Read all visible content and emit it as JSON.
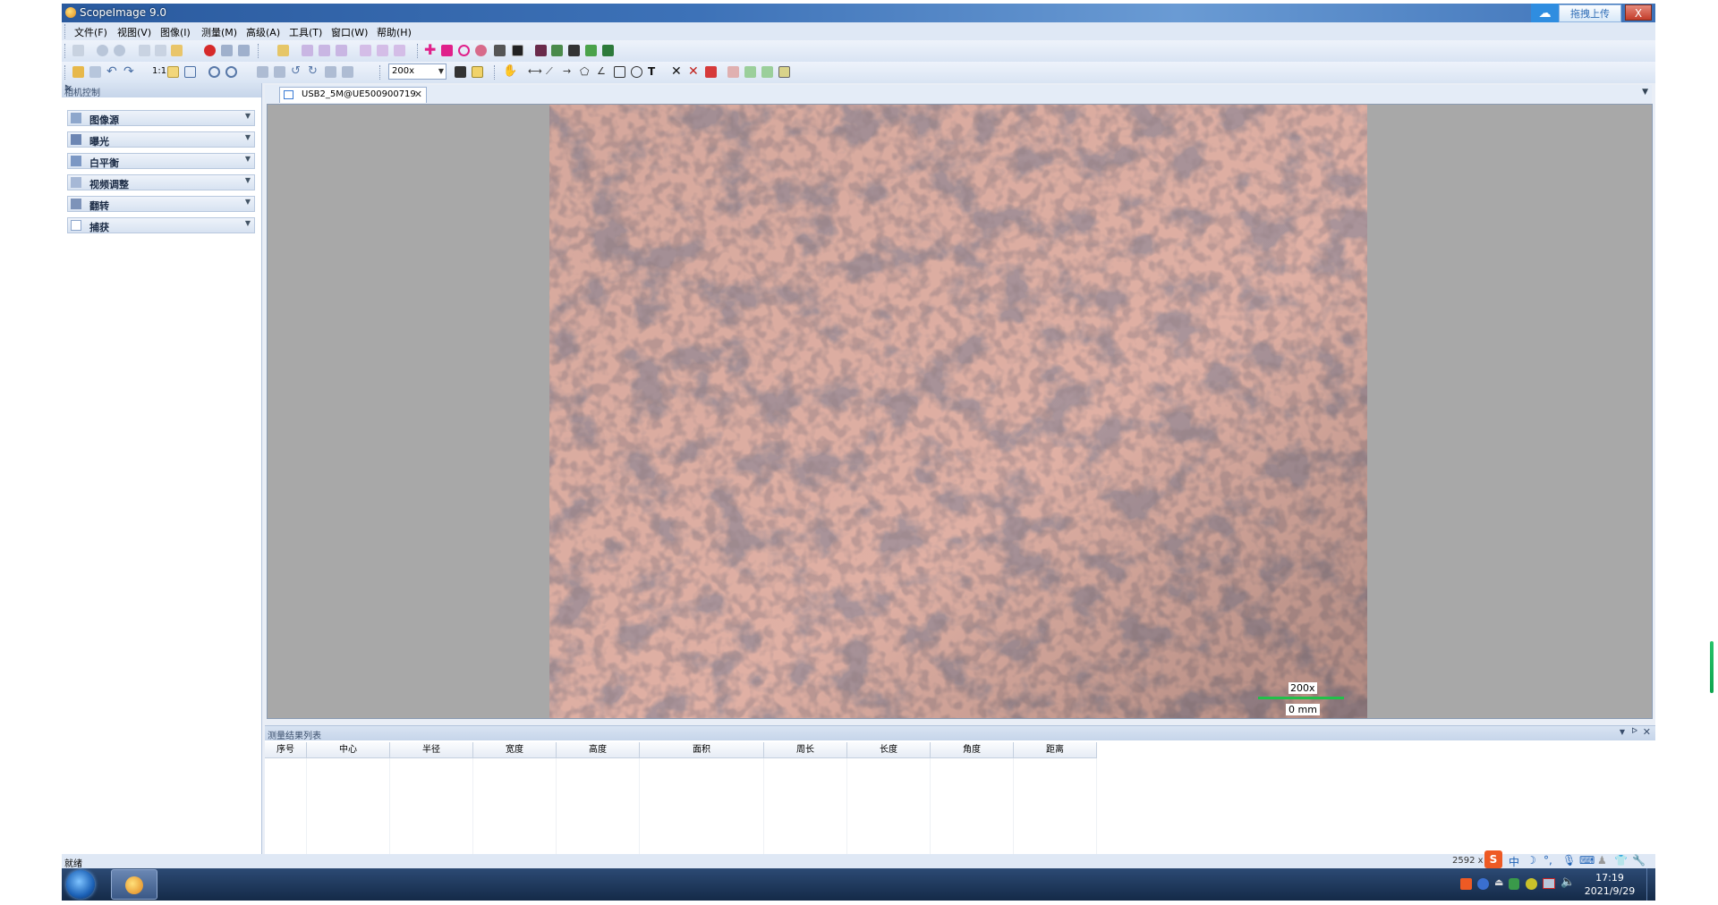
{
  "window": {
    "title": "ScopeImage 9.0",
    "upload_button": "拖拽上传",
    "close_label": "X"
  },
  "menu": [
    {
      "label": "文件(F)"
    },
    {
      "label": "视图(V)"
    },
    {
      "label": "图像(I)"
    },
    {
      "label": "测量(M)"
    },
    {
      "label": "高级(A)"
    },
    {
      "label": "工具(T)"
    },
    {
      "label": "窗口(W)"
    },
    {
      "label": "帮助(H)"
    }
  ],
  "toolbar": {
    "zoom_value": "200x",
    "one_to_one": "1:1"
  },
  "left_panel": {
    "title": "相机控制",
    "items": [
      {
        "label": "图像源"
      },
      {
        "label": "曝光"
      },
      {
        "label": "白平衡"
      },
      {
        "label": "视频调整"
      },
      {
        "label": "翻转"
      },
      {
        "label": "捕获"
      }
    ]
  },
  "document": {
    "tab_label": "USB2_5M@UE500900719",
    "scale_label": "200x",
    "scale_value": "0 mm"
  },
  "results": {
    "title": "测量结果列表",
    "columns": [
      "序号",
      "中心",
      "半径",
      "宽度",
      "高度",
      "面积",
      "周长",
      "长度",
      "角度",
      "距离"
    ]
  },
  "status": {
    "ready": "就绪",
    "resolution": "2592 x 1"
  },
  "taskbar": {
    "time": "17:19",
    "date": "2021/9/29",
    "ime_lang": "中"
  },
  "colors": {
    "accent": "#3d72b8",
    "panel_bg": "#e9eef6",
    "viewer_bg": "#a8a8a8",
    "scale_line": "#22c04a"
  }
}
